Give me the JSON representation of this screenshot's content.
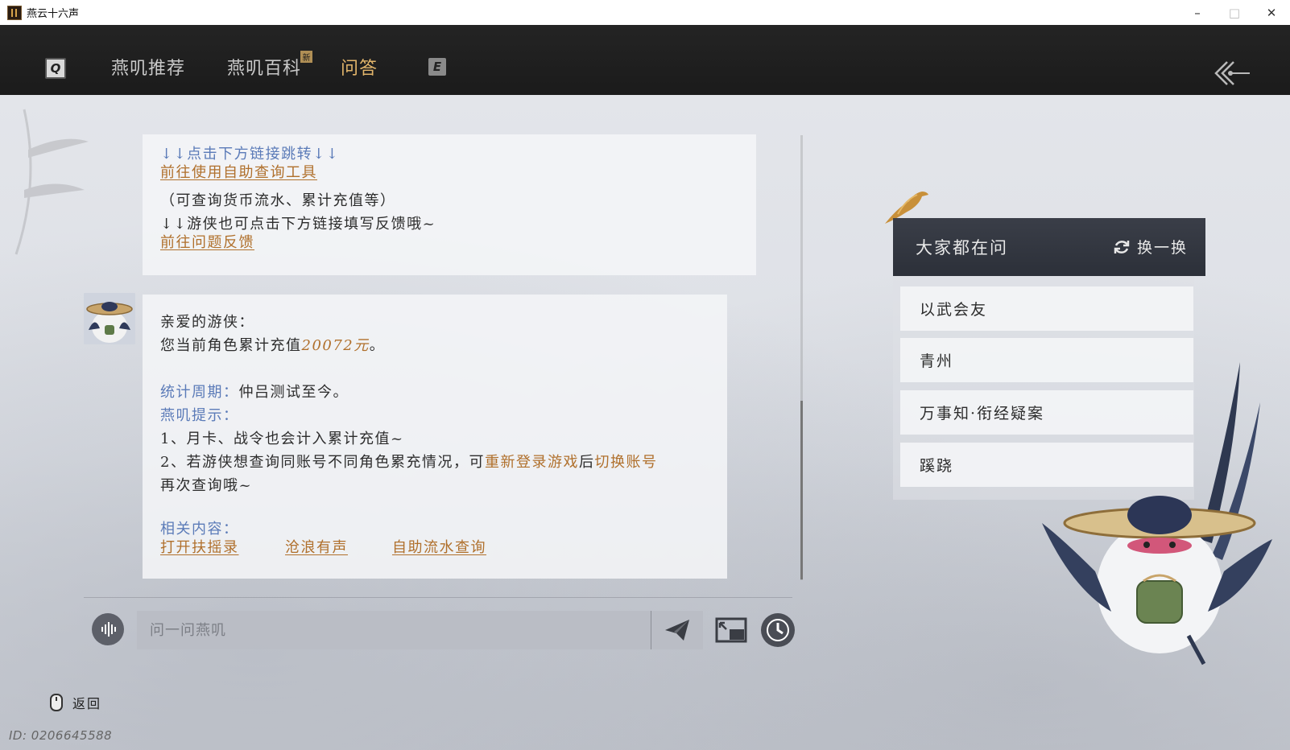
{
  "window": {
    "title": "燕云十六声",
    "minimize": "–",
    "maximize": "□",
    "close": "✕"
  },
  "nav": {
    "key_left": "Q",
    "key_right": "E",
    "tabs": [
      {
        "label": "燕叽推荐",
        "active": false
      },
      {
        "label": "燕叽百科",
        "active": false,
        "badge": "新"
      },
      {
        "label": "问答",
        "active": true
      }
    ],
    "accent_color": "#e2b56b"
  },
  "chat": {
    "message1": {
      "hint": "↓↓点击下方链接跳转↓↓",
      "link1": "前往使用自助查询工具",
      "note": "（可查询货币流水、累计充值等）",
      "hint2": "↓↓游侠也可点击下方链接填写反馈哦~",
      "link2": "前往问题反馈"
    },
    "message2": {
      "greeting": "亲爱的游侠：",
      "recharge_prefix": "您当前角色累计充值",
      "recharge_amount": "20072元",
      "recharge_suffix": "。",
      "period_label": "统计周期：",
      "period_value": "仲吕测试至今。",
      "tip_label": "燕叽提示：",
      "tip1": "1、月卡、战令也会计入累计充值~",
      "tip2_prefix": "2、若游侠想查询同账号不同角色累充情况，可",
      "tip2_link1": "重新登录游戏",
      "tip2_mid": "后",
      "tip2_link2": "切换账号",
      "tip2_cont": "再次查询哦~",
      "related_label": "相关内容：",
      "related": [
        "打开扶摇录",
        "沧浪有声",
        "自助流水查询"
      ]
    }
  },
  "input": {
    "placeholder": "问一问燕叽"
  },
  "panel": {
    "title": "大家都在问",
    "refresh_label": "换一换",
    "questions": [
      "以武会友",
      "青州",
      "万事知·衔经疑案",
      "蹊跷"
    ]
  },
  "footer": {
    "back_label": "返回",
    "uid": "ID: 0206645588"
  }
}
